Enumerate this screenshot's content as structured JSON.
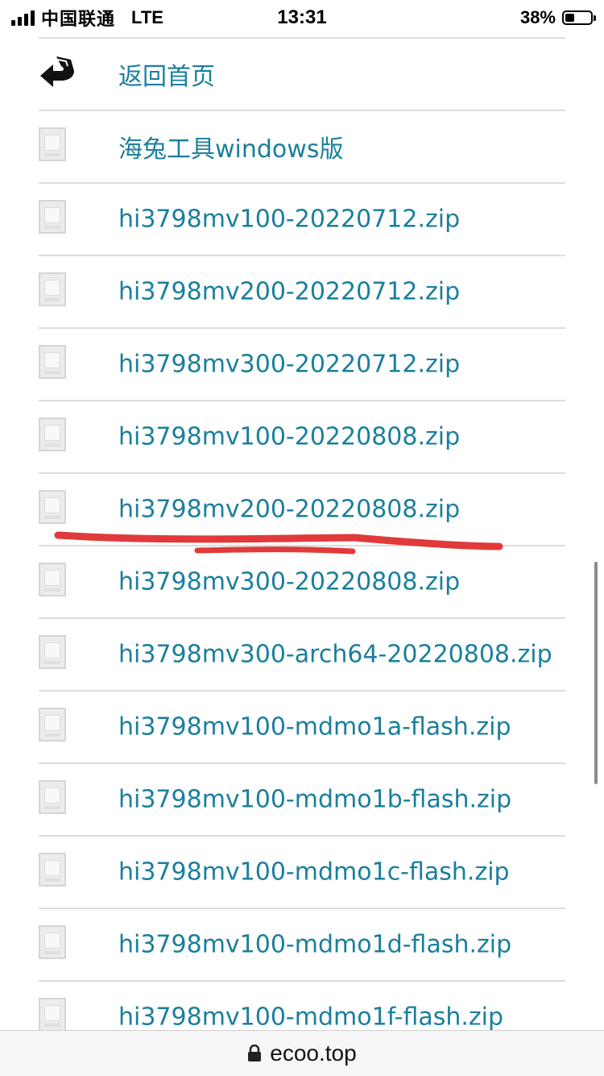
{
  "status_bar": {
    "carrier": "中国联通",
    "network": "LTE",
    "time": "13:31",
    "battery_percent": "38%",
    "battery_level": 0.38
  },
  "directory": {
    "items": [
      {
        "label": "返回首页",
        "icon": "back-arrow-icon",
        "type": "back"
      },
      {
        "label": "海兔工具windows版",
        "icon": "file-icon",
        "type": "folder"
      },
      {
        "label": "hi3798mv100-20220712.zip",
        "icon": "file-icon",
        "type": "file"
      },
      {
        "label": "hi3798mv200-20220712.zip",
        "icon": "file-icon",
        "type": "file"
      },
      {
        "label": "hi3798mv300-20220712.zip",
        "icon": "file-icon",
        "type": "file"
      },
      {
        "label": "hi3798mv100-20220808.zip",
        "icon": "file-icon",
        "type": "file"
      },
      {
        "label": "hi3798mv200-20220808.zip",
        "icon": "file-icon",
        "type": "file"
      },
      {
        "label": "hi3798mv300-20220808.zip",
        "icon": "file-icon",
        "type": "file"
      },
      {
        "label": "hi3798mv300-arch64-20220808.zip",
        "icon": "file-icon",
        "type": "file"
      },
      {
        "label": "hi3798mv100-mdmo1a-flash.zip",
        "icon": "file-icon",
        "type": "file"
      },
      {
        "label": "hi3798mv100-mdmo1b-flash.zip",
        "icon": "file-icon",
        "type": "file"
      },
      {
        "label": "hi3798mv100-mdmo1c-flash.zip",
        "icon": "file-icon",
        "type": "file"
      },
      {
        "label": "hi3798mv100-mdmo1d-flash.zip",
        "icon": "file-icon",
        "type": "file"
      },
      {
        "label": "hi3798mv100-mdmo1f-flash.zip",
        "icon": "file-icon",
        "type": "file"
      }
    ],
    "link_color": "#1a7f9c"
  },
  "annotation": {
    "color": "#e03a3a"
  },
  "url_bar": {
    "domain": "ecoo.top",
    "lock_icon": "lock-icon"
  }
}
